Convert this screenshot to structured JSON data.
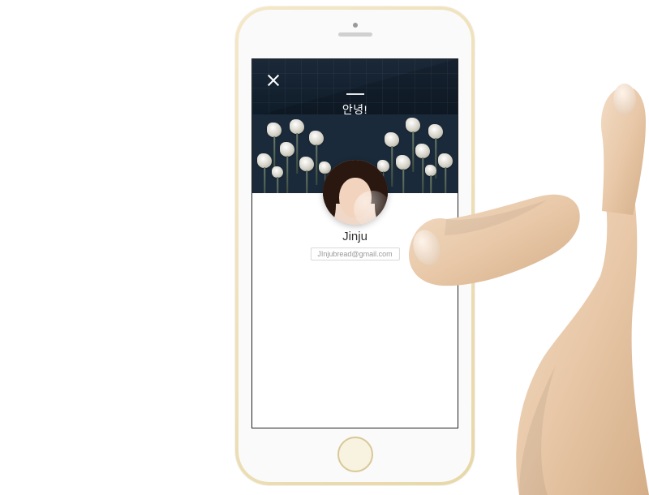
{
  "profile": {
    "greeting": "안녕!",
    "name": "Jinju",
    "email": "JInjubread@gmail.com"
  },
  "icons": {
    "close": "close-icon"
  }
}
